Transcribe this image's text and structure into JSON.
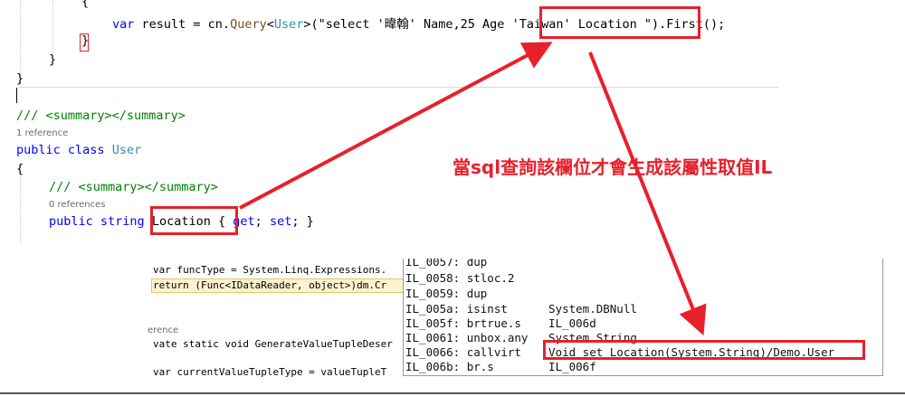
{
  "top_code": {
    "brace_open": "{",
    "line_var": "var",
    "line_result": " result = cn.",
    "line_query": "Query",
    "line_lt": "<",
    "line_user_type": "User",
    "line_args_a": ">(\"select '",
    "line_name_cjk": "暐翰",
    "line_args_b": "' Name,25 Age ",
    "line_tw": "'Taiwan' Location ",
    "line_quote": "\"",
    "line_tail": ").First();",
    "brace_inner_close": "}",
    "brace_method_close": "}",
    "brace_class_close": "}"
  },
  "class_code": {
    "summary1": "/// <summary></summary>",
    "refs1": "1 reference",
    "public_kw": "public",
    "class_kw": "class",
    "class_name": "User",
    "brace_open": "{",
    "summary2": "/// <summary></summary>",
    "refs2": "0 references",
    "prop_public": "public",
    "prop_type": "string",
    "prop_name": "Location",
    "prop_accessors_a": "{ ",
    "prop_get": "get",
    "prop_sep": "; ",
    "prop_set": "set",
    "prop_accessors_b": "; }"
  },
  "annotation": "當sql查詢該欄位才會生成該屬性取值IL",
  "background_code": {
    "line1": "var funcType = System.Linq.Expressions.",
    "line2": "return (Func<IDataReader, object>)dm.Cr",
    "line3": "erence",
    "line4": "vate static void GenerateValueTupleDeser",
    "line5": "var currentValueTupleType = valueTupleT"
  },
  "il_lines": [
    {
      "text": "IL_0057: dup"
    },
    {
      "text": "IL_0058: stloc.2"
    },
    {
      "text": "IL_0059: dup"
    },
    {
      "text": "IL_005a: isinst      System.DBNull"
    },
    {
      "text": "IL_005f: brtrue.s    IL_006d"
    },
    {
      "text": "IL_0061: unbox.any   System.String"
    },
    {
      "text": "IL_0066: callvirt    Void set_Location(System.String)/Demo.User"
    },
    {
      "text": "IL_006b: br.s        IL_006f"
    }
  ],
  "colors": {
    "annotation_red": "#e8202a",
    "keyword": "#0000ff",
    "type": "#2b91af"
  }
}
